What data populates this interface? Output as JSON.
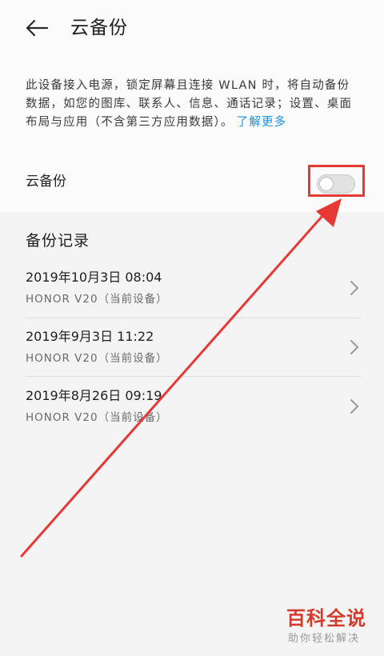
{
  "header": {
    "title": "云备份",
    "back_icon": "arrow-left-icon"
  },
  "description": {
    "text": "此设备接入电源，锁定屏幕且连接 WLAN 时，将自动备份数据，如您的图库、联系人、信息、通话记录；设置、桌面布局与应用（不含第三方应用数据）。",
    "link": "了解更多"
  },
  "cloud_backup_toggle": {
    "label": "云备份",
    "state": "off"
  },
  "records_section": {
    "title": "备份记录",
    "items": [
      {
        "date": "2019年10月3日 08:04",
        "device": "HONOR V20（当前设备）"
      },
      {
        "date": "2019年9月3日 11:22",
        "device": "HONOR V20（当前设备）"
      },
      {
        "date": "2019年8月26日 09:19",
        "device": "HONOR V20（当前设备）"
      }
    ]
  },
  "watermark": {
    "title": "百科全说",
    "subtitle": "助你轻松解决"
  },
  "colors": {
    "accent_link": "#1d8fe0",
    "annotation_red": "#e53935",
    "watermark_red": "#d23c2f"
  }
}
